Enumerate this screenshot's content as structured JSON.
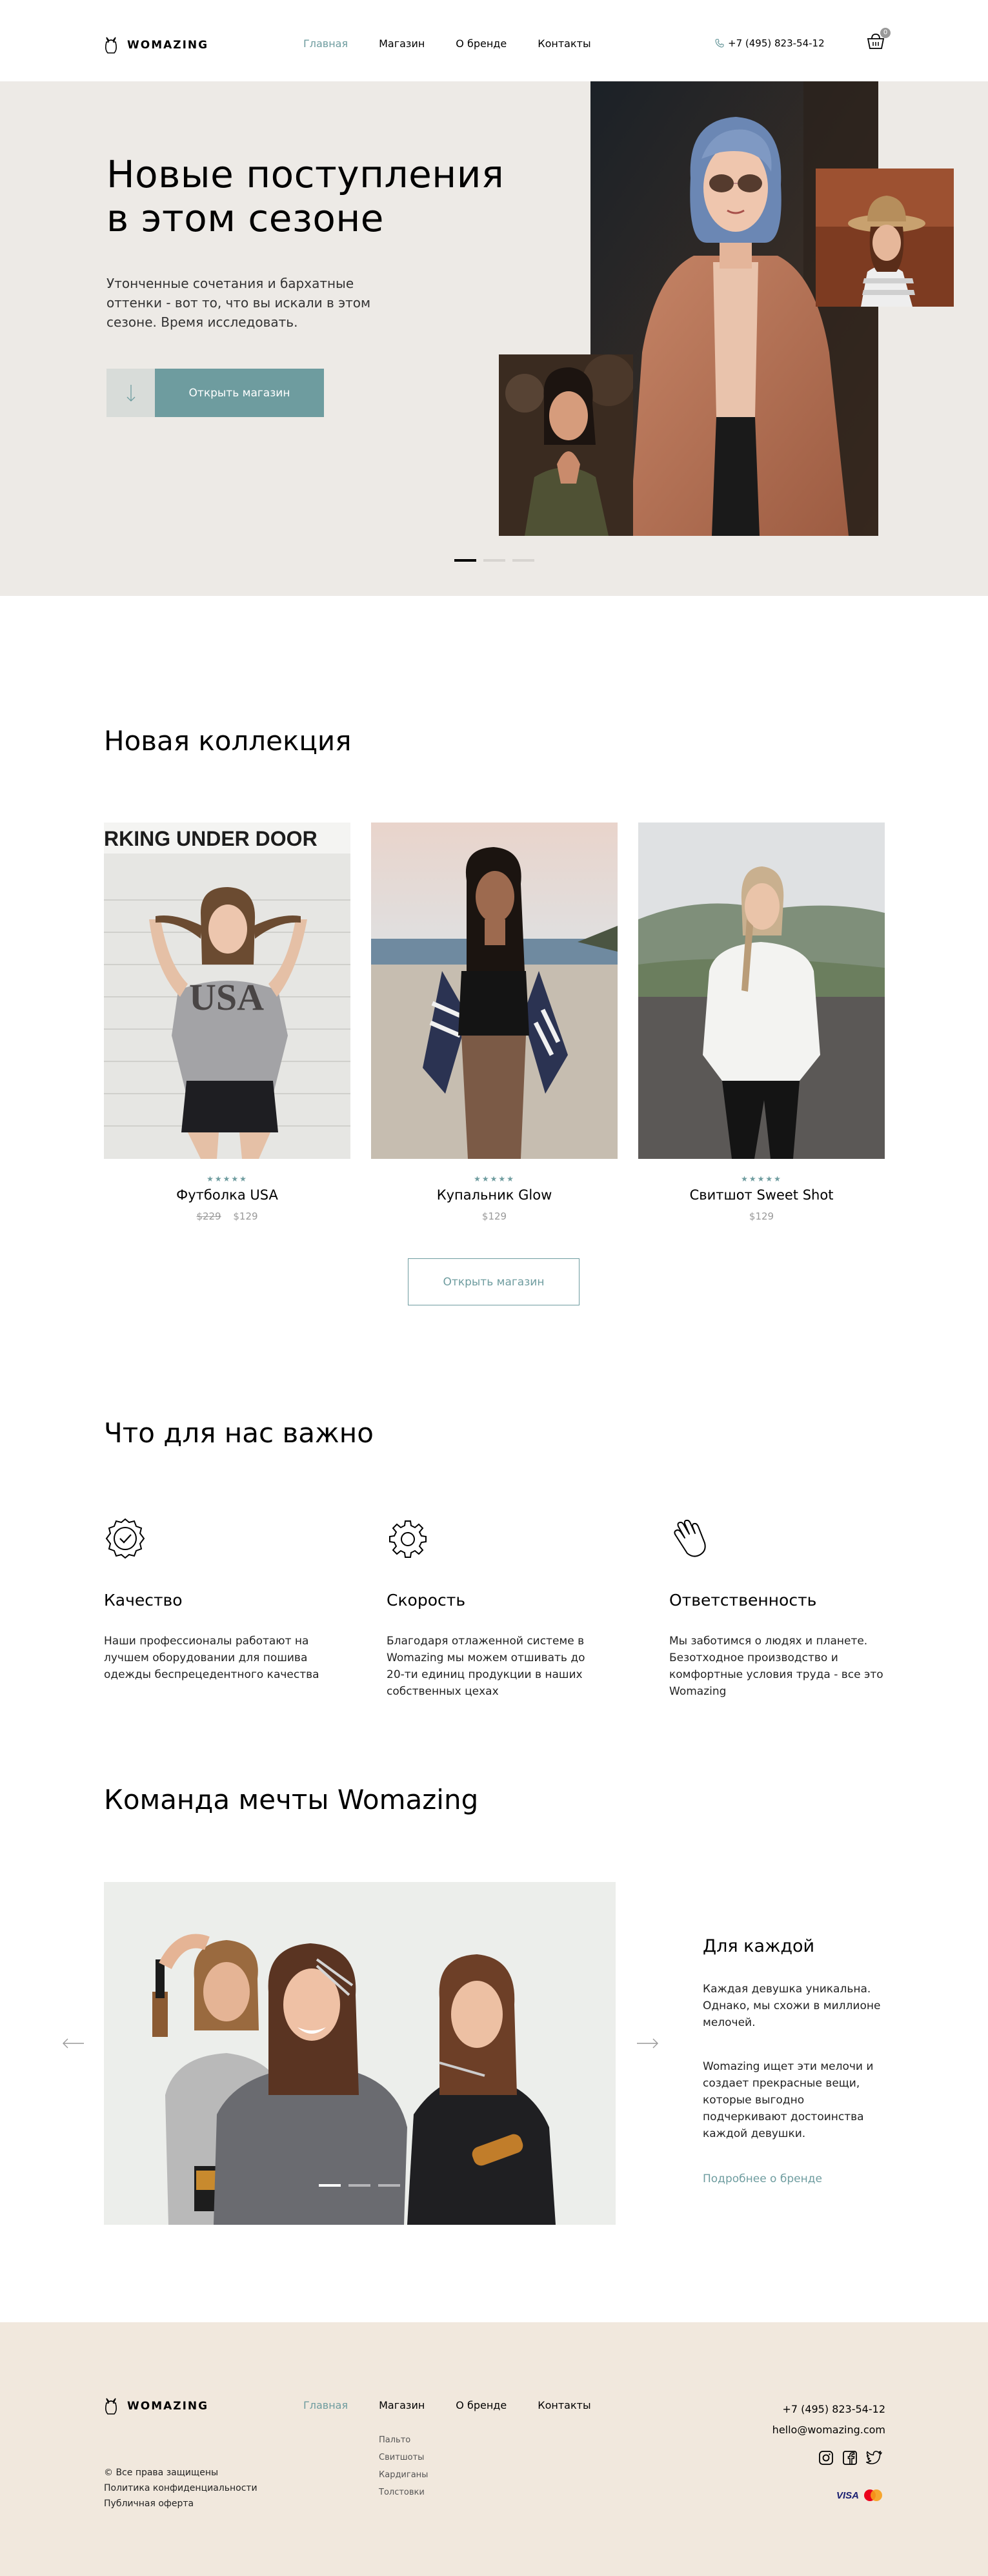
{
  "header": {
    "logo_text": "WOMAZING",
    "nav": [
      {
        "label": "Главная",
        "active": true
      },
      {
        "label": "Магазин",
        "active": false
      },
      {
        "label": "О бренде",
        "active": false
      },
      {
        "label": "Контакты",
        "active": false
      }
    ],
    "phone": "+7 (495) 823-54-12",
    "cart_count": "0"
  },
  "hero": {
    "title_line1": "Новые поступления",
    "title_line2": "в этом сезоне",
    "text": "Утонченные сочетания и бархатные оттенки - вот то, что вы искали в этом сезоне. Время исследовать.",
    "button": "Открыть магазин",
    "slides_total": 3,
    "active_slide": 1
  },
  "collection": {
    "title": "Новая коллекция",
    "products": [
      {
        "name": "Футболка USA",
        "old_price": "$229",
        "price": "$129",
        "stars": "★★★★★",
        "shirt_text": "USA",
        "sign_text": "RKING UNDER DOOR"
      },
      {
        "name": "Купальник Glow",
        "old_price": "",
        "price": "$129",
        "stars": "★★★★★"
      },
      {
        "name": "Свитшот Sweet Shot",
        "old_price": "",
        "price": "$129",
        "stars": "★★★★★"
      }
    ],
    "button": "Открыть магазин"
  },
  "values": {
    "title": "Что для нас важно",
    "items": [
      {
        "title": "Качество",
        "text": "Наши профессионалы работают на лучшем оборудовании для пошива одежды беспрецедентного качества",
        "icon": "quality-badge-icon"
      },
      {
        "title": "Скорость",
        "text": "Благодаря отлаженной системе в Womazing мы можем отшивать до 20-ти единиц продукции в наших собственных цехах",
        "icon": "gear-icon"
      },
      {
        "title": "Ответственность",
        "text": "Мы заботимся о людях и планете. Безотходное производство и комфортные условия труда - все это Womazing",
        "icon": "hand-icon"
      }
    ]
  },
  "team": {
    "title": "Команда мечты Womazing",
    "subtitle": "Для каждой",
    "p1": "Каждая девушка уникальна. Однако, мы схожи в миллионе мелочей.",
    "p2": "Womazing ищет эти мелочи и создает прекрасные вещи, которые выгодно подчеркивают достоинства каждой девушки.",
    "link": "Подробнее о бренде",
    "slides_total": 3,
    "active_slide": 1
  },
  "footer": {
    "logo_text": "WOMAZING",
    "nav": [
      {
        "label": "Главная",
        "active": true
      },
      {
        "label": "Магазин",
        "active": false
      },
      {
        "label": "О бренде",
        "active": false
      },
      {
        "label": "Контакты",
        "active": false
      }
    ],
    "shop_links": [
      "Пальто",
      "Свитшоты",
      "Кардиганы",
      "Толстовки"
    ],
    "copyright": "© Все права защищены",
    "privacy": "Политика конфиденциальности",
    "offer": "Публичная оферта",
    "phone": "+7 (495) 823-54-12",
    "email": "hello@womazing.com",
    "payment": "VISA"
  },
  "colors": {
    "accent": "#6E9C9F",
    "hero_bg": "#EDEAE6",
    "footer_bg": "#F1E8DD"
  }
}
